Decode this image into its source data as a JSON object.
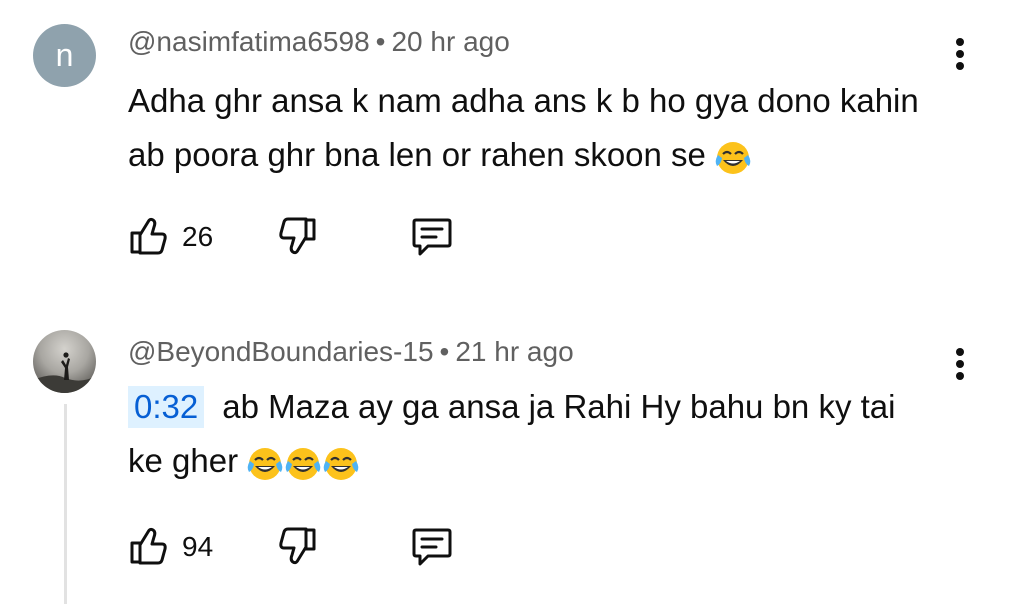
{
  "comments": [
    {
      "avatar_letter": "n",
      "author": "@nasimfatima6598",
      "separator": "•",
      "time": "20 hr ago",
      "text": "Adha ghr ansa k nam adha ans k b ho gya dono kahin ab poora ghr bna len or rahen skoon se",
      "emojis": [
        "face-with-tears-of-joy"
      ],
      "likes": "26"
    },
    {
      "author": "@BeyondBoundaries-15",
      "separator": "•",
      "time": "21 hr ago",
      "timestamp_link": "0:32",
      "text": "ab Maza ay ga ansa ja Rahi Hy bahu bn ky tai ke gher",
      "emojis": [
        "face-with-tears-of-joy",
        "face-with-tears-of-joy",
        "face-with-tears-of-joy"
      ],
      "likes": "94"
    }
  ],
  "colors": {
    "text": "#0f0f0f",
    "meta": "#606060",
    "timestamp_text": "#065fd4",
    "timestamp_bg": "#def1ff",
    "avatar_letter_bg": "#8fa2ad"
  },
  "icons": [
    "like-icon",
    "dislike-icon",
    "reply-icon",
    "more-vert-icon",
    "face-with-tears-of-joy-emoji"
  ]
}
